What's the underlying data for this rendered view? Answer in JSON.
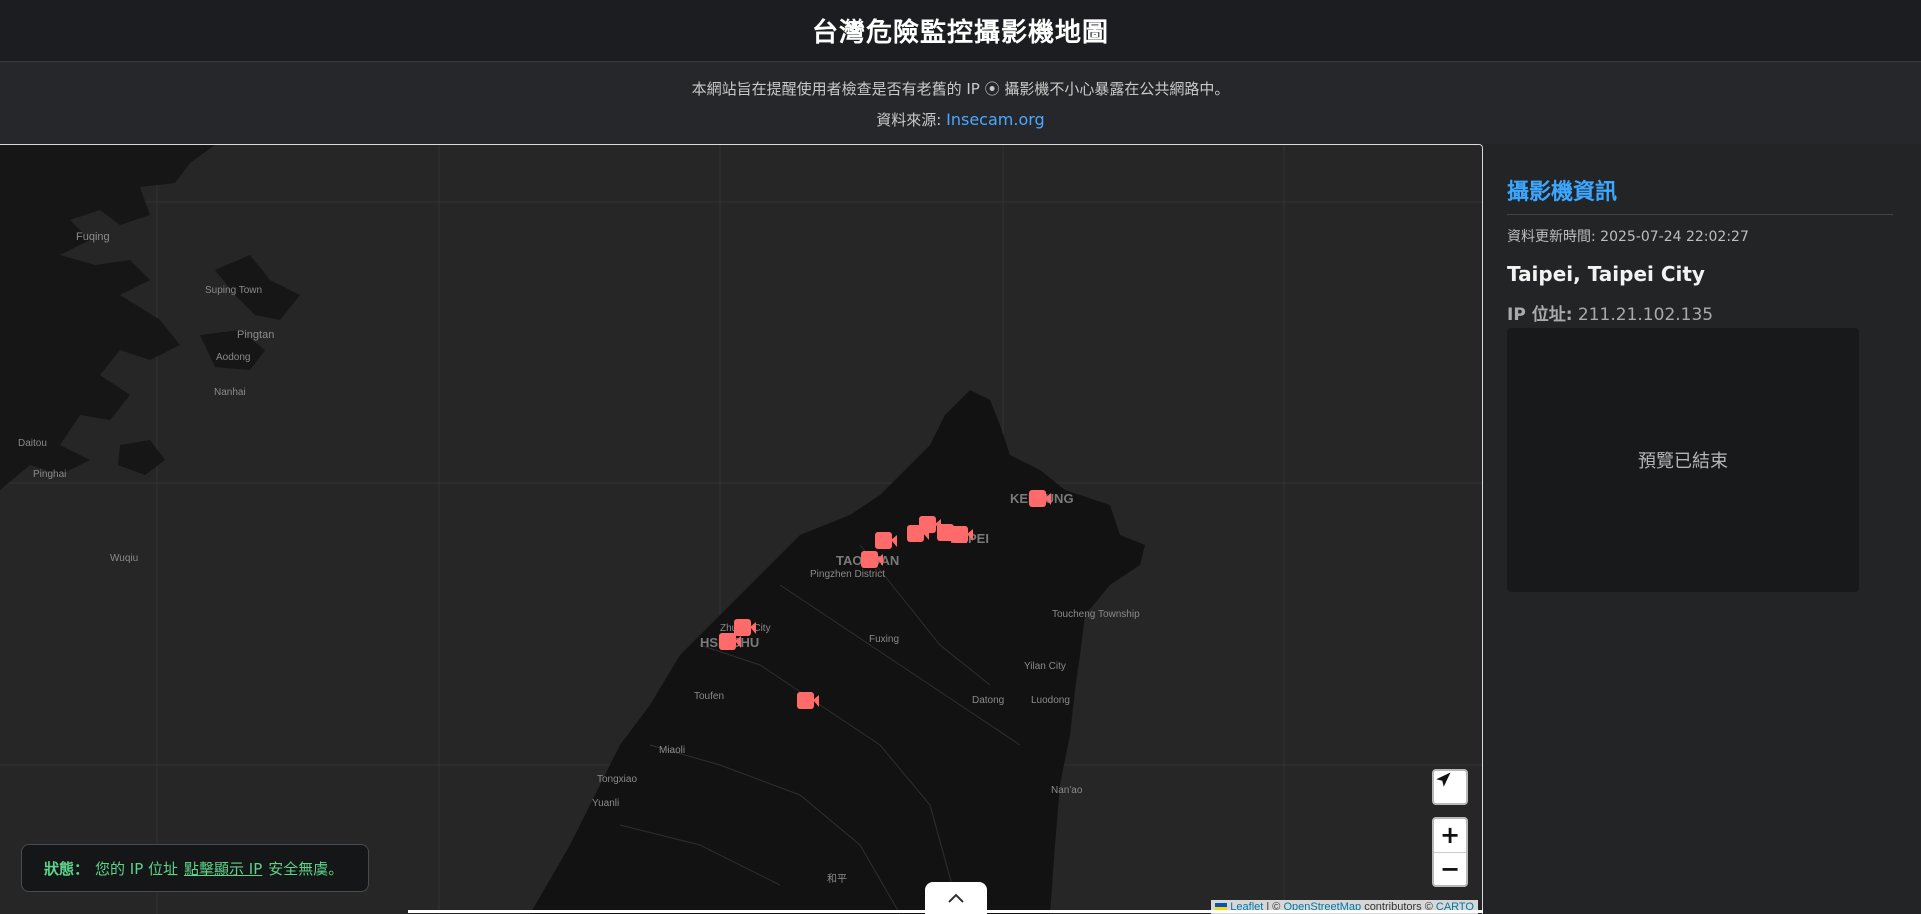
{
  "header": {
    "title": "台灣危險監控攝影機地圖"
  },
  "notice": {
    "text": "本網站旨在提醒使用者檢查是否有老舊的 IP ⦿ 攝影機不小心暴露在公共網路中。",
    "source_label": "資料來源:",
    "source_link": "Insecam.org"
  },
  "map": {
    "labels": {
      "fuqing": "Fuqing",
      "suping": "Suping Town",
      "pingtan": "Pingtan",
      "aodong": "Aodong",
      "nanhai": "Nanhai",
      "daitou": "Daitou",
      "pinghai": "Pinghai",
      "wuqiu": "Wuqiu",
      "keelung": "KEELUNG",
      "taipei": "TAIPEI",
      "taoyuan": "TAOYUAN",
      "pingzhen": "Pingzhen District",
      "hsinchu": "HSINCHU",
      "zhubei": "Zhubei City",
      "fuxing": "Fuxing",
      "toucheng": "Toucheng Township",
      "yilan": "Yilan City",
      "toufen": "Toufen",
      "datong": "Datong",
      "luodong": "Luodong",
      "miaoli": "Miaoli",
      "tongxiao": "Tongxiao",
      "yuanli": "Yuanli",
      "nanao": "Nan'ao",
      "heping": "和平"
    },
    "marker_color": "#ff6b6b",
    "controls": {
      "zoom_in": "+",
      "zoom_out": "−",
      "locate_icon": "navigation-arrow-icon"
    },
    "attribution": {
      "leaflet": "Leaflet",
      "sep": "| ©",
      "osm": "OpenStreetMap",
      "contributors": "contributors ©",
      "carto": "CARTO"
    }
  },
  "status": {
    "label": "狀態：",
    "text1": "您的 IP 位址",
    "link": "點擊顯示 IP",
    "text2": "安全無虞。"
  },
  "panel": {
    "title": "攝影機資訊",
    "updated": "資料更新時間: 2025-07-24 22:02:27",
    "city": "Taipei, Taipei City",
    "ip_label": "IP 位址:",
    "ip_value": "211.21.102.135",
    "preview_text": "預覽已結束"
  }
}
